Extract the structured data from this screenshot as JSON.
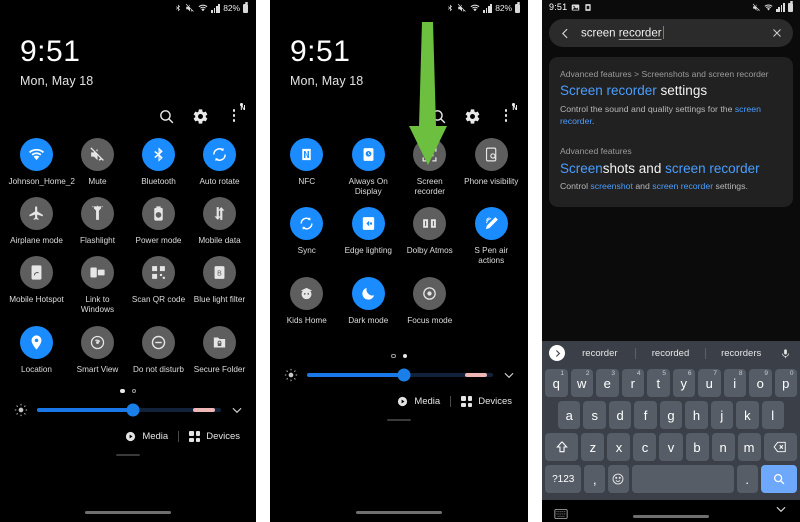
{
  "panel1": {
    "status": {
      "time": "",
      "battery": "82%",
      "icons": [
        "bluetooth-icon",
        "mute-icon",
        "wifi-icon",
        "signal-icon"
      ]
    },
    "clock": {
      "time": "9:51",
      "date": "Mon, May 18"
    },
    "header": {
      "search_icon": "search-icon",
      "settings_icon": "gear-icon",
      "menu_icon": "kebab-menu-icon",
      "badge": "N"
    },
    "tiles": [
      {
        "label": "Johnson_Home_2",
        "icon": "wifi-icon",
        "on": true
      },
      {
        "label": "Mute",
        "icon": "mute-icon",
        "on": false
      },
      {
        "label": "Bluetooth",
        "icon": "bluetooth-icon",
        "on": true
      },
      {
        "label": "Auto rotate",
        "icon": "auto-rotate-icon",
        "on": true
      },
      {
        "label": "Airplane mode",
        "icon": "airplane-icon",
        "on": false
      },
      {
        "label": "Flashlight",
        "icon": "flashlight-icon",
        "on": false
      },
      {
        "label": "Power mode",
        "icon": "power-mode-icon",
        "on": false
      },
      {
        "label": "Mobile data",
        "icon": "mobile-data-icon",
        "on": false
      },
      {
        "label": "Mobile Hotspot",
        "icon": "hotspot-icon",
        "on": false
      },
      {
        "label": "Link to Windows",
        "icon": "link-to-windows-icon",
        "on": false
      },
      {
        "label": "Scan QR code",
        "icon": "qr-code-icon",
        "on": false
      },
      {
        "label": "Blue light filter",
        "icon": "blue-light-icon",
        "on": false
      },
      {
        "label": "Location",
        "icon": "location-pin-icon",
        "on": true
      },
      {
        "label": "Smart View",
        "icon": "smart-view-icon",
        "on": false
      },
      {
        "label": "Do not disturb",
        "icon": "do-not-disturb-icon",
        "on": false
      },
      {
        "label": "Secure Folder",
        "icon": "secure-folder-icon",
        "on": false
      }
    ],
    "dots": {
      "count": 2,
      "active": 0
    },
    "brightness": {
      "value": 52
    },
    "footer": {
      "media": "Media",
      "devices": "Devices"
    }
  },
  "panel2": {
    "status": {
      "battery": "82%"
    },
    "clock": {
      "time": "9:51",
      "date": "Mon, May 18"
    },
    "header": {
      "badge": "N"
    },
    "arrow": {
      "color": "#6abf3a",
      "points_to": "Screen recorder"
    },
    "tiles": [
      {
        "label": "NFC",
        "icon": "nfc-icon",
        "on": true
      },
      {
        "label": "Always On Display",
        "icon": "always-on-display-icon",
        "on": true
      },
      {
        "label": "Screen recorder",
        "icon": "screen-recorder-icon",
        "on": false
      },
      {
        "label": "Phone visibility",
        "icon": "phone-visibility-icon",
        "on": false
      },
      {
        "label": "Sync",
        "icon": "sync-icon",
        "on": true
      },
      {
        "label": "Edge lighting",
        "icon": "edge-lighting-icon",
        "on": true
      },
      {
        "label": "Dolby Atmos",
        "icon": "dolby-atmos-icon",
        "on": false
      },
      {
        "label": "S Pen air actions",
        "icon": "s-pen-air-actions-icon",
        "on": true
      },
      {
        "label": "Kids Home",
        "icon": "kids-home-icon",
        "on": false
      },
      {
        "label": "Dark mode",
        "icon": "dark-mode-moon-icon",
        "on": true
      },
      {
        "label": "Focus mode",
        "icon": "focus-mode-icon",
        "on": false
      }
    ],
    "dots": {
      "count": 2,
      "active": 1
    },
    "brightness": {
      "value": 52
    },
    "footer": {
      "media": "Media",
      "devices": "Devices"
    }
  },
  "panel3": {
    "status": {
      "time": "9:51",
      "left_icons": [
        "image-icon",
        "screenshot-icon"
      ],
      "right_icons": [
        "mute-icon",
        "wifi-icon",
        "signal-icon",
        "battery-icon"
      ]
    },
    "search": {
      "back_icon": "back-chevron-icon",
      "query_plain": "screen ",
      "query_underlined": "recorder",
      "clear_icon": "close-icon"
    },
    "results": [
      {
        "breadcrumb": "Advanced features > Screenshots and screen recorder",
        "title_parts": [
          {
            "text": "Screen recorder",
            "highlight": true
          },
          {
            "text": " settings",
            "highlight": false
          }
        ],
        "desc_parts": [
          {
            "text": "Control the sound and quality settings for the ",
            "highlight": false
          },
          {
            "text": "screen recorder",
            "highlight": true
          },
          {
            "text": ".",
            "highlight": false
          }
        ]
      },
      {
        "breadcrumb": "Advanced features",
        "title_parts": [
          {
            "text": "Screen",
            "highlight": true
          },
          {
            "text": "shots and ",
            "highlight": false
          },
          {
            "text": "screen recorder",
            "highlight": true
          }
        ],
        "desc_parts": [
          {
            "text": "Control ",
            "highlight": false
          },
          {
            "text": "screenshot",
            "highlight": true
          },
          {
            "text": " and ",
            "highlight": false
          },
          {
            "text": "screen recorder",
            "highlight": true
          },
          {
            "text": " settings.",
            "highlight": false
          }
        ]
      }
    ],
    "keyboard": {
      "suggestions": [
        "recorder",
        "recorded",
        "recorders"
      ],
      "toggle_icon": "chevron-right-icon",
      "mic_icon": "microphone-icon",
      "row1": [
        {
          "k": "q",
          "n": "1"
        },
        {
          "k": "w",
          "n": "2"
        },
        {
          "k": "e",
          "n": "3"
        },
        {
          "k": "r",
          "n": "4"
        },
        {
          "k": "t",
          "n": "5"
        },
        {
          "k": "y",
          "n": "6"
        },
        {
          "k": "u",
          "n": "7"
        },
        {
          "k": "i",
          "n": "8"
        },
        {
          "k": "o",
          "n": "9"
        },
        {
          "k": "p",
          "n": "0"
        }
      ],
      "row2": [
        "a",
        "s",
        "d",
        "f",
        "g",
        "h",
        "j",
        "k",
        "l"
      ],
      "row3": [
        "z",
        "x",
        "c",
        "v",
        "b",
        "n",
        "m"
      ],
      "shift_icon": "shift-arrow-icon",
      "backspace_icon": "backspace-icon",
      "num_key": "?123",
      "comma_key": ",",
      "emoji_key": "emoji-icon",
      "space_key": "",
      "dot_key": ".",
      "search_key": "search-icon",
      "bottom_left_icon": "keyboard-icon",
      "bottom_right_icon": "chevron-down-icon"
    }
  },
  "colors": {
    "accent_blue": "#1a8cff",
    "tile_off": "#5e5e5e",
    "link_blue": "#4a9eff",
    "arrow_green": "#6abf3a",
    "badge_orange": "#f0601a",
    "key_bg": "#565d66",
    "kb_bg": "#3b4048"
  }
}
